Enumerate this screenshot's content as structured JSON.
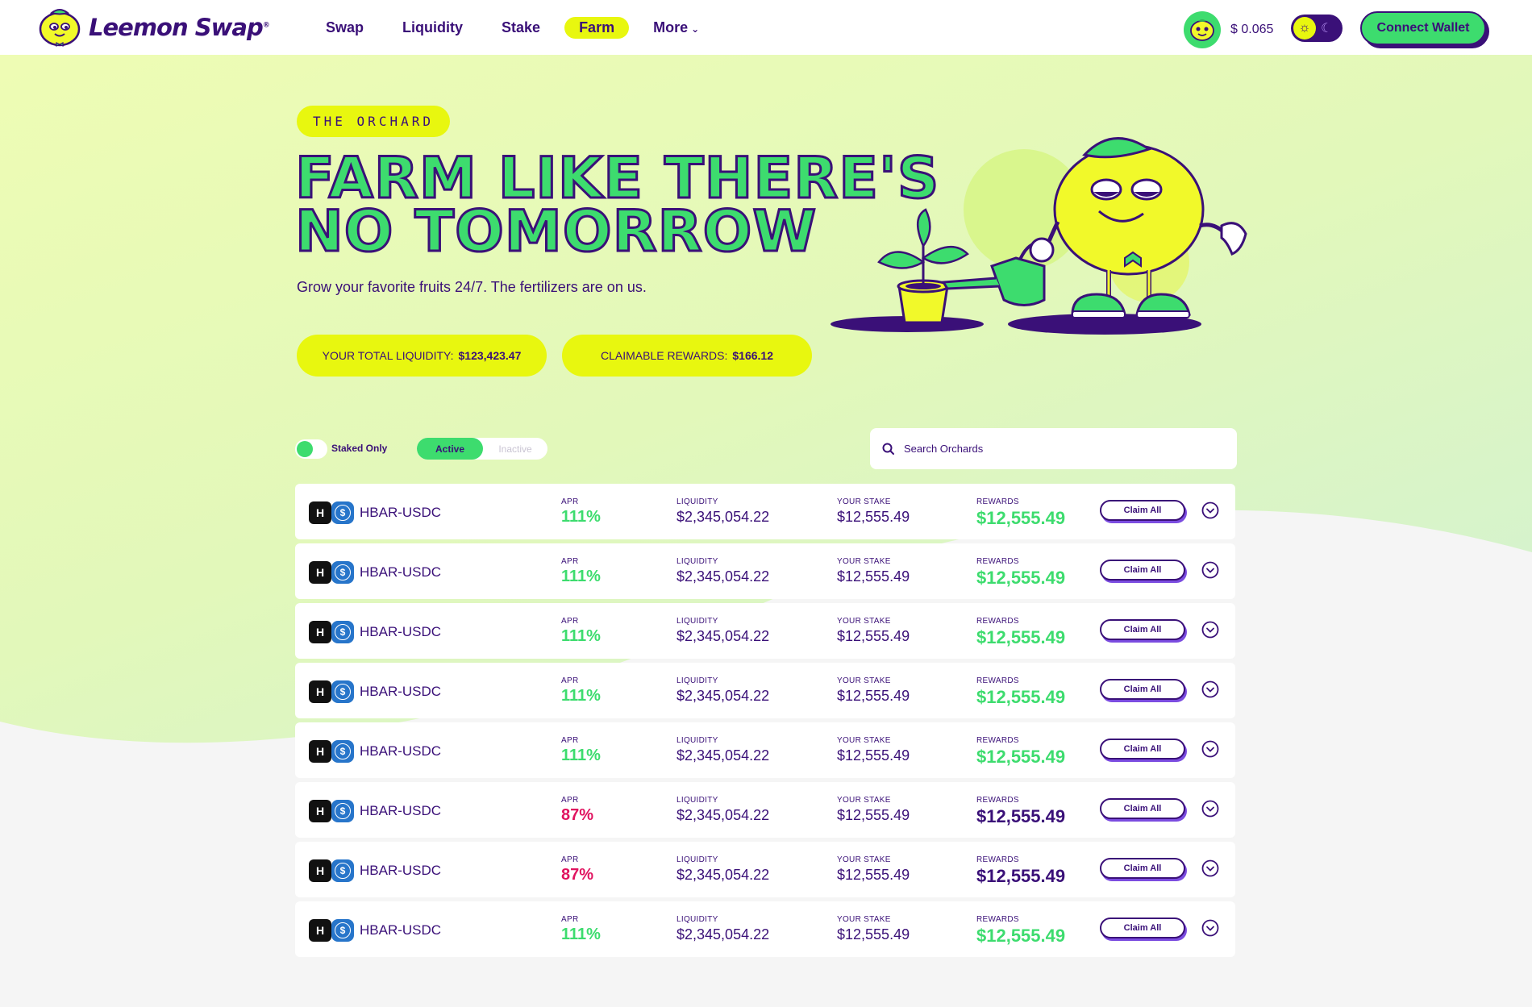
{
  "header": {
    "logo_text": "Leemon Swap",
    "logo_mark": "®",
    "nav": [
      {
        "label": "Swap",
        "active": false
      },
      {
        "label": "Liquidity",
        "active": false
      },
      {
        "label": "Stake",
        "active": false
      },
      {
        "label": "Farm",
        "active": true
      },
      {
        "label": "More",
        "active": false
      }
    ],
    "price": "$ 0.065",
    "connect_label": "Connect Wallet"
  },
  "hero": {
    "badge": "THE ORCHARD",
    "title_line1": "FARM LIKE THERE'S",
    "title_line2": "NO TOMORROW",
    "subtitle": "Grow your favorite fruits 24/7. The fertilizers are on us.",
    "total_liquidity_label": "YOUR TOTAL LIQUIDITY:",
    "total_liquidity_value": "$123,423.47",
    "claimable_label": "CLAIMABLE REWARDS:",
    "claimable_value": "$166.12"
  },
  "controls": {
    "staked_only_label": "Staked Only",
    "active_label": "Active",
    "inactive_label": "Inactive",
    "search_placeholder": "Search Orchards"
  },
  "columns": {
    "apr": "APR",
    "liquidity": "LIQUIDITY",
    "stake": "YOUR STAKE",
    "rewards": "REWARDS",
    "claim": "Claim All"
  },
  "colors": {
    "green": "#3ddc6e",
    "red": "#e0135f",
    "purple": "#3a1078",
    "yellow": "#e8f70f"
  },
  "rows": [
    {
      "pair": "HBAR-USDC",
      "apr": "111%",
      "positive": true,
      "liquidity": "$2,345,054.22",
      "stake": "$12,555.49",
      "rewards": "$12,555.49"
    },
    {
      "pair": "HBAR-USDC",
      "apr": "111%",
      "positive": true,
      "liquidity": "$2,345,054.22",
      "stake": "$12,555.49",
      "rewards": "$12,555.49"
    },
    {
      "pair": "HBAR-USDC",
      "apr": "111%",
      "positive": true,
      "liquidity": "$2,345,054.22",
      "stake": "$12,555.49",
      "rewards": "$12,555.49"
    },
    {
      "pair": "HBAR-USDC",
      "apr": "111%",
      "positive": true,
      "liquidity": "$2,345,054.22",
      "stake": "$12,555.49",
      "rewards": "$12,555.49"
    },
    {
      "pair": "HBAR-USDC",
      "apr": "111%",
      "positive": true,
      "liquidity": "$2,345,054.22",
      "stake": "$12,555.49",
      "rewards": "$12,555.49"
    },
    {
      "pair": "HBAR-USDC",
      "apr": "87%",
      "positive": false,
      "liquidity": "$2,345,054.22",
      "stake": "$12,555.49",
      "rewards": "$12,555.49"
    },
    {
      "pair": "HBAR-USDC",
      "apr": "87%",
      "positive": false,
      "liquidity": "$2,345,054.22",
      "stake": "$12,555.49",
      "rewards": "$12,555.49"
    },
    {
      "pair": "HBAR-USDC",
      "apr": "111%",
      "positive": true,
      "liquidity": "$2,345,054.22",
      "stake": "$12,555.49",
      "rewards": "$12,555.49"
    }
  ]
}
